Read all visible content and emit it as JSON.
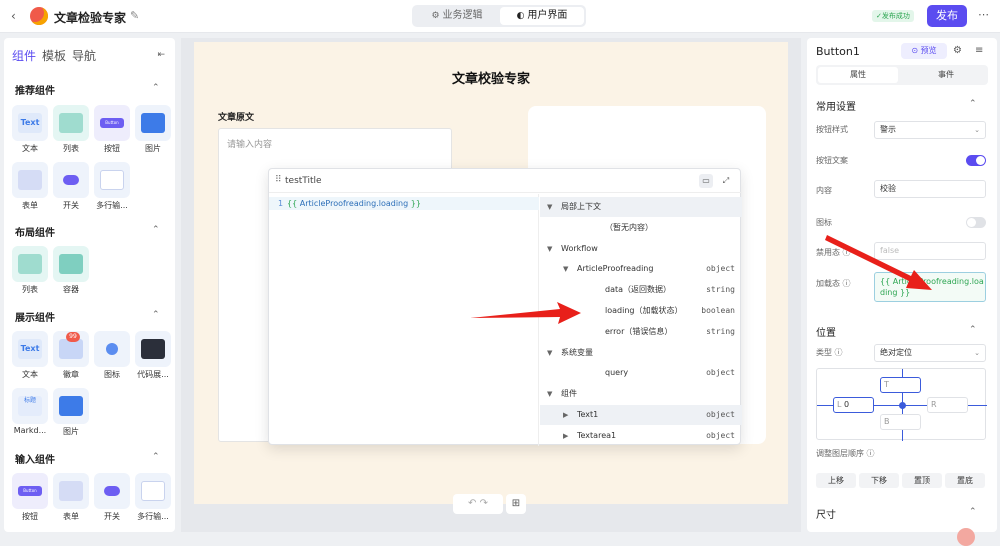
{
  "topbar": {
    "title": "文章检验专家",
    "tabs": [
      "业务逻辑",
      "用户界面"
    ],
    "status": "发布成功",
    "publish": "发布"
  },
  "left": {
    "tabs": [
      "组件",
      "模板",
      "导航"
    ],
    "sections": [
      {
        "title": "推荐组件",
        "items": [
          "文本",
          "列表",
          "按钮",
          "图片",
          "表单",
          "开关",
          "多行输..."
        ]
      },
      {
        "title": "布局组件",
        "items": [
          "列表",
          "容器"
        ]
      },
      {
        "title": "展示组件",
        "items": [
          "文本",
          "徽章",
          "图标",
          "代码展...",
          "Markd...",
          "图片"
        ]
      },
      {
        "title": "输入组件",
        "items": [
          "按钮",
          "表单",
          "开关",
          "多行输..."
        ]
      }
    ],
    "tile_texts": {
      "text": "Text",
      "button": "Button",
      "badge": "99",
      "markdown": "标题"
    }
  },
  "canvas": {
    "title": "文章校验专家",
    "label": "文章原文",
    "placeholder": "请输入内容"
  },
  "popup": {
    "title": "testTitle",
    "line_no": "1",
    "code_pre": "{{ ",
    "code_var": "ArticleProofreading.loading",
    "code_post": " }}",
    "tree": [
      {
        "label": "局部上下文",
        "type": "",
        "level": 0,
        "arrow": "▼",
        "sel": true
      },
      {
        "label": "（暂无内容）",
        "type": "",
        "level": 2,
        "arrow": ""
      },
      {
        "label": "Workflow",
        "type": "",
        "level": 0,
        "arrow": "▼"
      },
      {
        "label": "ArticleProofreading",
        "type": "object",
        "level": 1,
        "arrow": "▼"
      },
      {
        "label": "data（返回数据）",
        "type": "string",
        "level": 2,
        "arrow": ""
      },
      {
        "label": "loading（加载状态）",
        "type": "boolean",
        "level": 2,
        "arrow": ""
      },
      {
        "label": "error（错误信息）",
        "type": "string",
        "level": 2,
        "arrow": ""
      },
      {
        "label": "系统变量",
        "type": "",
        "level": 0,
        "arrow": "▼"
      },
      {
        "label": "query",
        "type": "object",
        "level": 2,
        "arrow": ""
      },
      {
        "label": "组件",
        "type": "",
        "level": 0,
        "arrow": "▼"
      },
      {
        "label": "Text1",
        "type": "object",
        "level": 1,
        "arrow": "▶",
        "sel": true
      },
      {
        "label": "Textarea1",
        "type": "object",
        "level": 1,
        "arrow": "▶"
      }
    ]
  },
  "right": {
    "component": "Button1",
    "preview": "预览",
    "tabs": [
      "属性",
      "事件"
    ],
    "common": "常用设置",
    "style_label": "按钮样式",
    "style_value": "警示",
    "text_label": "按钮文案",
    "content_label": "内容",
    "content_value": "校验",
    "icon_label": "图标",
    "disabled_label": "禁用态",
    "disabled_placeholder": "false",
    "loading_label": "加载态",
    "loading_value": "{{ ArticleProofreading.loading }}",
    "position": "位置",
    "type_label": "类型",
    "type_value": "绝对定位",
    "pos": {
      "T": "T",
      "L": "L",
      "L_value": "0",
      "R": "R",
      "B": "B"
    },
    "layer_label": "调整图层顺序",
    "layer_buttons": [
      "上移",
      "下移",
      "置顶",
      "置底"
    ],
    "size": "尺寸"
  },
  "colors": {
    "accent": "#5b4cf0",
    "arrow": "#e8201a",
    "green": "#2ea653"
  }
}
